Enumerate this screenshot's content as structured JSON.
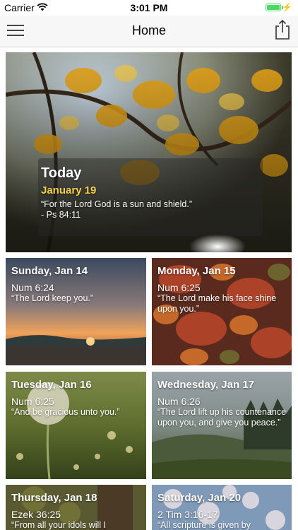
{
  "status_bar": {
    "carrier": "Carrier",
    "time": "3:01 PM",
    "battery_level": 1.0
  },
  "nav": {
    "title": "Home"
  },
  "hero": {
    "title": "Today",
    "date": "January 19",
    "verse": "“For the Lord God is a sun and shield.”",
    "reference": "- Ps 84:11"
  },
  "cards": [
    {
      "day": "Sunday, Jan 14",
      "ref": "Num 6:24",
      "verse": "“The Lord keep you.”"
    },
    {
      "day": "Monday, Jan 15",
      "ref": "Num 6:25",
      "verse": "“The Lord make his face shine upon you.”"
    },
    {
      "day": "Tuesday, Jan 16",
      "ref": "Num 6:25",
      "verse": "“And be gracious unto you.”"
    },
    {
      "day": "Wednesday, Jan 17",
      "ref": "Num 6:26",
      "verse": "“The Lord lift up his countenance upon you, and give you peace.”"
    },
    {
      "day": "Thursday, Jan 18",
      "ref": "Ezek 36:25",
      "verse": "“From all your idols will I"
    },
    {
      "day": "Saturday, Jan 20",
      "ref": "2 Tim 3:16-17",
      "verse": "“All scripture is given by"
    }
  ]
}
